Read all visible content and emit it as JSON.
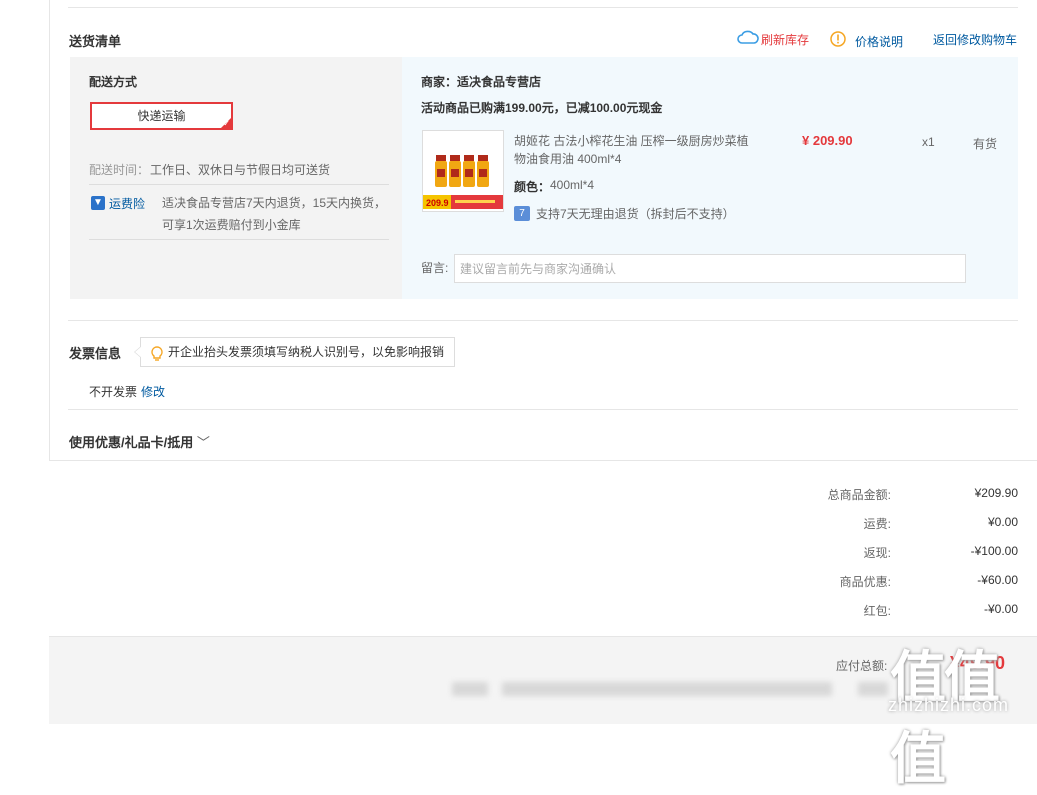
{
  "delivery": {
    "title": "送货清单",
    "refresh_stock": "刷新库存",
    "price_note": "价格说明",
    "back_to_cart": "返回修改购物车",
    "method_label": "配送方式",
    "method_value": "快递运输",
    "time_label": "配送时间：",
    "time_value": "工作日、双休日与节假日均可送货",
    "insurance_label": "运费险",
    "insurance_text_1": "适决食品专营店7天内退货，15天内换货，",
    "insurance_text_2": "可享1次运费赔付到小金库"
  },
  "shop": {
    "merchant": "商家：适决食品专营店",
    "promotion": "活动商品已购满199.00元，已减100.00元现金",
    "product": {
      "name_line1": "胡姬花 古法小榨花生油 压榨一级厨房炒菜植",
      "name_line2": "物油食用油 400ml*4",
      "price": "¥ 209.90",
      "qty": "x1",
      "stock": "有货",
      "color_label": "颜色：",
      "color_value": "400ml*4",
      "return_policy": "支持7天无理由退货（拆封后不支持）",
      "img_badge": "209.9"
    },
    "message_label": "留言:",
    "message_placeholder": "建议留言前先与商家沟通确认"
  },
  "invoice": {
    "title": "发票信息",
    "tip": "开企业抬头发票须填写纳税人识别号，以免影响报销",
    "status": "不开发票",
    "edit": "修改"
  },
  "coupon": {
    "title": "使用优惠/礼品卡/抵用",
    "chevron": "﹀"
  },
  "summary": [
    {
      "label": "总商品金额:",
      "value": "¥209.90"
    },
    {
      "label": "运费:",
      "value": "¥0.00"
    },
    {
      "label": "返现:",
      "value": "-¥100.00"
    },
    {
      "label": "商品优惠:",
      "value": "-¥60.00"
    },
    {
      "label": "红包:",
      "value": "-¥0.00"
    }
  ],
  "payable": {
    "label": "应付总额:",
    "value": "¥49.90"
  },
  "watermark": {
    "big": "值值值",
    "small": "zhizhizhi.com"
  },
  "colors": {
    "accent_red": "#e4393c",
    "link_blue": "#005aa0",
    "right_panel_bg": "#f2f9fd"
  }
}
